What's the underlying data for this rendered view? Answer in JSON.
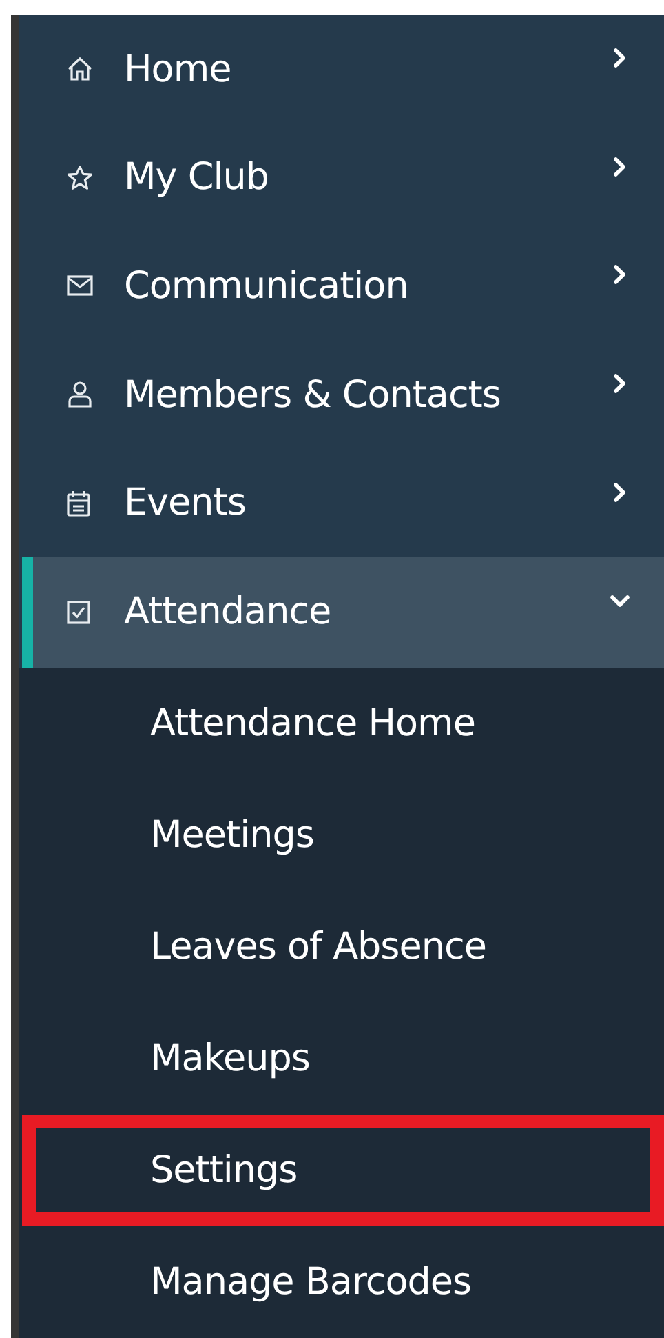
{
  "sidebar": {
    "items": [
      {
        "label": "Home",
        "selected": false,
        "expanded": false
      },
      {
        "label": "My Club",
        "selected": false,
        "expanded": false
      },
      {
        "label": "Communication",
        "selected": false,
        "expanded": false
      },
      {
        "label": "Members & Contacts",
        "selected": false,
        "expanded": false
      },
      {
        "label": "Events",
        "selected": false,
        "expanded": false
      },
      {
        "label": "Attendance",
        "selected": true,
        "expanded": true,
        "children": [
          {
            "label": "Attendance Home",
            "highlighted": false
          },
          {
            "label": "Meetings",
            "highlighted": false
          },
          {
            "label": "Leaves of Absence",
            "highlighted": false
          },
          {
            "label": "Makeups",
            "highlighted": false
          },
          {
            "label": "Settings",
            "highlighted": true
          },
          {
            "label": "Manage Barcodes",
            "highlighted": false
          }
        ]
      }
    ]
  }
}
